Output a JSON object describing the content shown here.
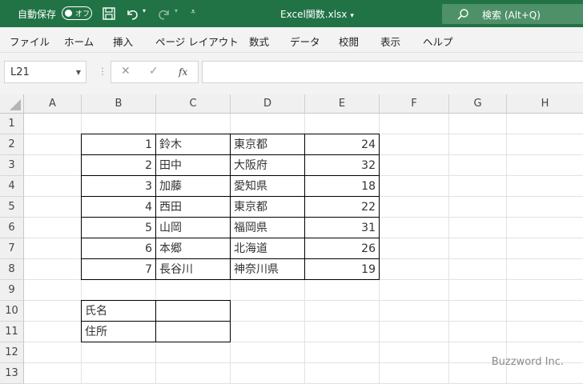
{
  "titlebar": {
    "autosave_label": "自動保存",
    "autosave_state": "オフ",
    "filename": "Excel関数.xlsx",
    "search_placeholder": "検索 (Alt+Q)",
    "icons": [
      "save-icon",
      "undo-icon",
      "redo-icon",
      "customize-qat-icon",
      "search-icon"
    ],
    "bg_color": "#217346"
  },
  "menu": [
    "ファイル",
    "ホーム",
    "挿入",
    "ページ レイアウト",
    "数式",
    "データ",
    "校閲",
    "表示",
    "ヘルプ"
  ],
  "formula_bar": {
    "name_box": "L21",
    "fx_label": "fx",
    "formula": ""
  },
  "columns": [
    "A",
    "B",
    "C",
    "D",
    "E",
    "F",
    "G",
    "H"
  ],
  "rows": [
    "1",
    "2",
    "3",
    "4",
    "5",
    "6",
    "7",
    "8",
    "9",
    "10",
    "11",
    "12",
    "13"
  ],
  "table": [
    {
      "no": "1",
      "name": "鈴木",
      "pref": "東京都",
      "age": "24"
    },
    {
      "no": "2",
      "name": "田中",
      "pref": "大阪府",
      "age": "32"
    },
    {
      "no": "3",
      "name": "加藤",
      "pref": "愛知県",
      "age": "18"
    },
    {
      "no": "4",
      "name": "西田",
      "pref": "東京都",
      "age": "22"
    },
    {
      "no": "5",
      "name": "山岡",
      "pref": "福岡県",
      "age": "31"
    },
    {
      "no": "6",
      "name": "本郷",
      "pref": "北海道",
      "age": "26"
    },
    {
      "no": "7",
      "name": "長谷川",
      "pref": "神奈川県",
      "age": "19"
    }
  ],
  "lookup": {
    "label_name": "氏名",
    "label_address": "住所",
    "value_name": "",
    "value_address": ""
  },
  "watermark": "Buzzword Inc."
}
